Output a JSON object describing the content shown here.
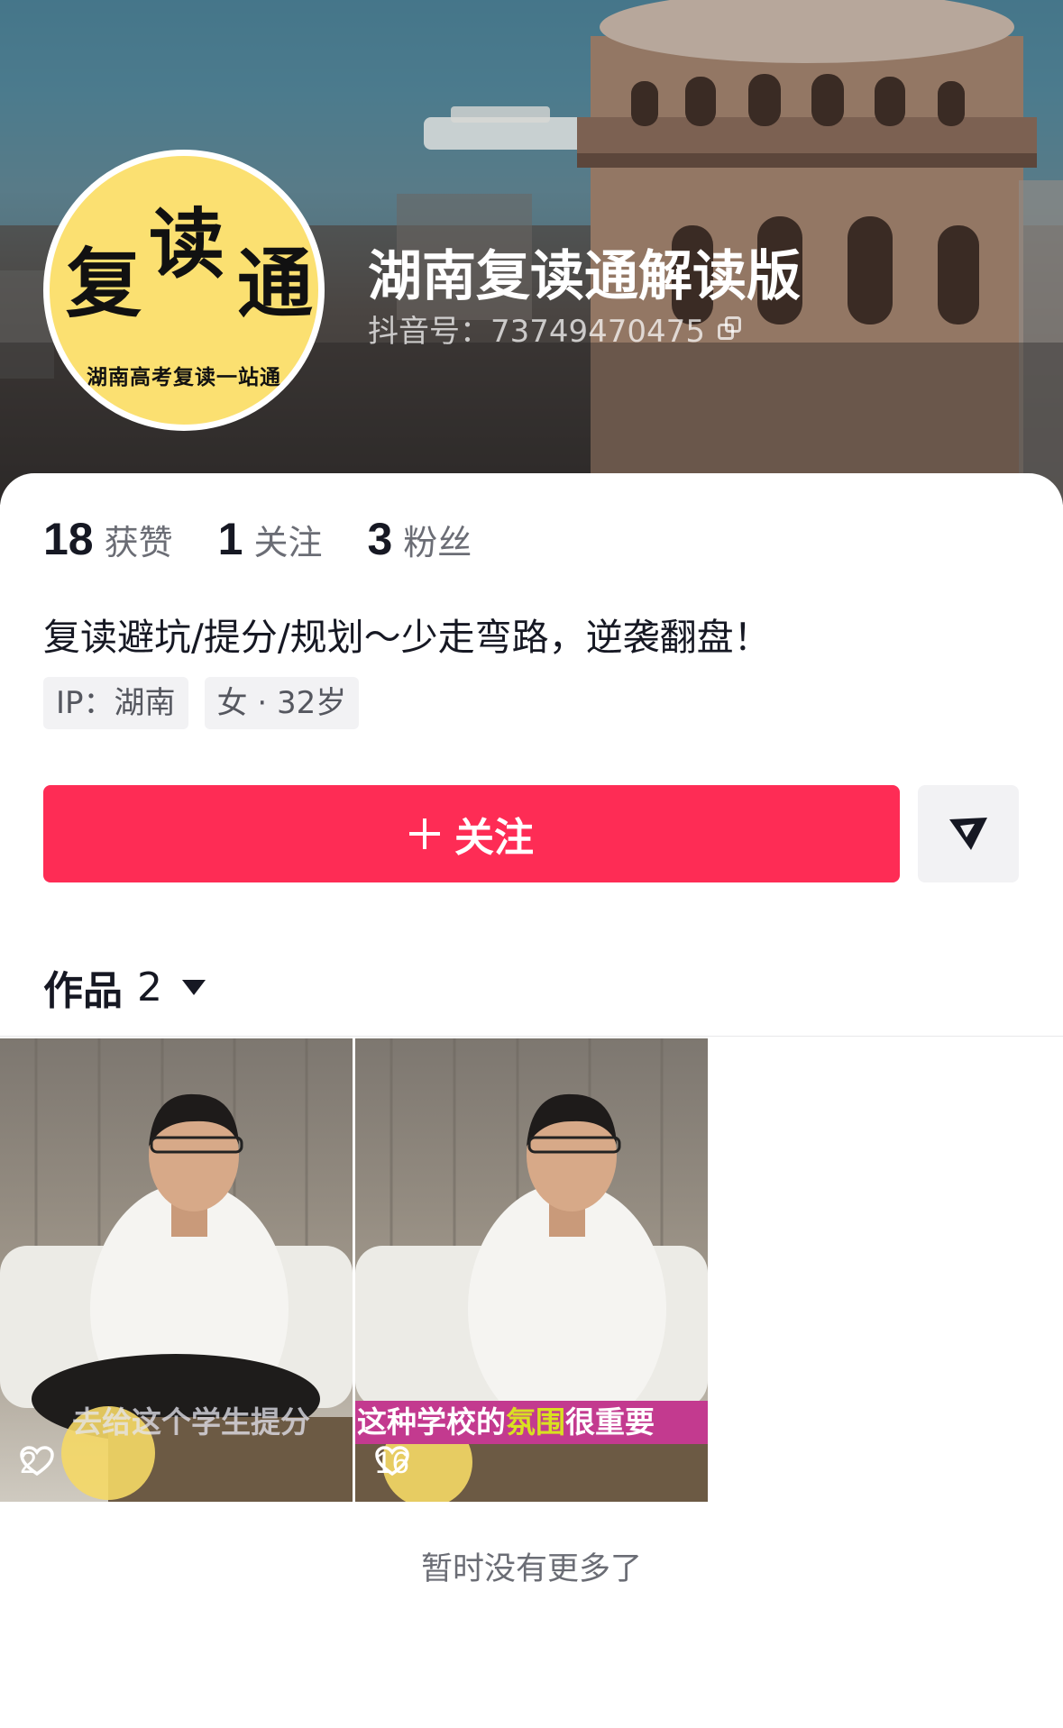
{
  "profile": {
    "name": "湖南复读通解读版",
    "douyin_id": "抖音号：73749470475",
    "avatar": {
      "char1": "复",
      "char2": "读",
      "char3": "通",
      "subtitle": "湖南高考复读一站通"
    },
    "stats": [
      {
        "num": "18",
        "label": "获赞"
      },
      {
        "num": "1",
        "label": "关注"
      },
      {
        "num": "3",
        "label": "粉丝"
      }
    ],
    "bio": "复读避坑/提分/规划～少走弯路，逆袭翻盘！",
    "tags": [
      "IP：湖南",
      "女 · 32岁"
    ]
  },
  "actions": {
    "follow_label": "关注",
    "message_icon": "send-icon"
  },
  "works": {
    "label": "作品",
    "count": "2",
    "items": [
      {
        "likes": "2",
        "caption": "去给这个学生提分"
      },
      {
        "likes": "16",
        "caption_pre": "这种学校的",
        "caption_highlight": "氛围",
        "caption_post": "很重要"
      }
    ]
  },
  "footer": {
    "end_text": "暂时没有更多了"
  },
  "colors": {
    "accent": "#fe2c55",
    "avatar_bg": "#fbe071"
  }
}
